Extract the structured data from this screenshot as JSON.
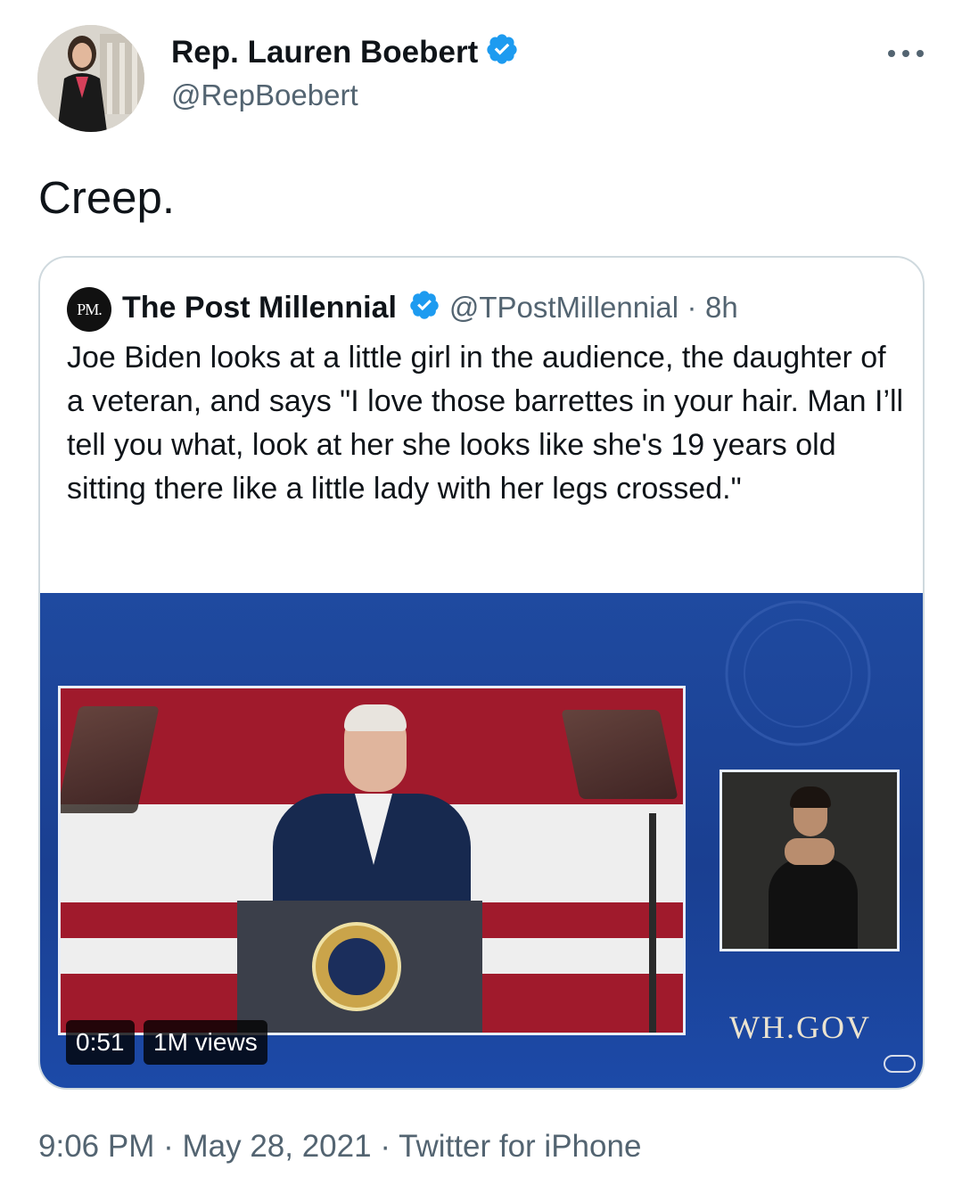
{
  "tweet": {
    "author": {
      "name": "Rep. Lauren Boebert",
      "handle": "@RepBoebert",
      "verified": true
    },
    "text": "Creep.",
    "more_icon": "more-horizontal-icon",
    "timestamp": "9:06 PM",
    "date": "May 28, 2021",
    "source": "Twitter for iPhone",
    "separator": "·"
  },
  "quote": {
    "logo_text": "PM.",
    "name": "The Post Millennial",
    "handle": "@TPostMillennial",
    "separator": "·",
    "time": "8h",
    "text": "Joe Biden looks at a little girl in the audience, the daughter of a veteran, and says \"I love those barrettes in your hair. Man I’ll tell you what, look at her she looks like she's 19 years old sitting there like a little lady with her legs crossed.\"",
    "video": {
      "duration": "0:51",
      "views": "1M views",
      "watermark": "WH.GOV"
    }
  },
  "colors": {
    "verified": "#1d9bf0",
    "secondary_text": "#536471",
    "border": "#cfd9de",
    "video_bg": "#1f4aa0"
  }
}
